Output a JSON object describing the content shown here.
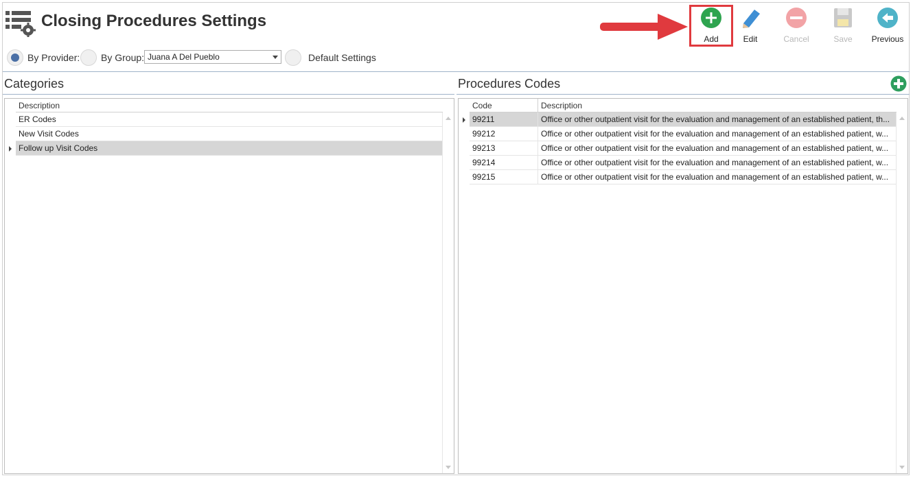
{
  "window": {
    "title": "Closing Procedures Settings"
  },
  "toolbar": {
    "add_label": "Add",
    "edit_label": "Edit",
    "cancel_label": "Cancel",
    "save_label": "Save",
    "previous_label": "Previous"
  },
  "filters": {
    "by_provider_label": "By Provider:",
    "by_group_label": "By Group:",
    "group_selected": "Juana A Del Pueblo",
    "default_label": "Default Settings",
    "selected": "By Provider"
  },
  "categories": {
    "title": "Categories",
    "header_description": "Description",
    "rows": [
      "ER Codes",
      "New Visit Codes",
      "Follow up Visit Codes"
    ],
    "selected_index": 2
  },
  "procedures": {
    "title": "Procedures Codes",
    "header_code": "Code",
    "header_description": "Description",
    "rows": [
      {
        "code": "99211",
        "description": "Office or other outpatient visit for the evaluation and management of an established patient, th..."
      },
      {
        "code": "99212",
        "description": "Office or other outpatient visit for the evaluation and management of an established patient, w..."
      },
      {
        "code": "99213",
        "description": "Office or other outpatient visit for the evaluation and management of an established patient, w..."
      },
      {
        "code": "99214",
        "description": "Office or other outpatient visit for the evaluation and management of an established patient, w..."
      },
      {
        "code": "99215",
        "description": "Office or other outpatient visit for the evaluation and management of an established patient, w..."
      }
    ],
    "selected_index": 0
  },
  "colors": {
    "accent": "#2ea44f",
    "highlight": "#e03a3e",
    "selected_row": "#d6d6d6",
    "radio_checked": "#4a6fa5"
  }
}
